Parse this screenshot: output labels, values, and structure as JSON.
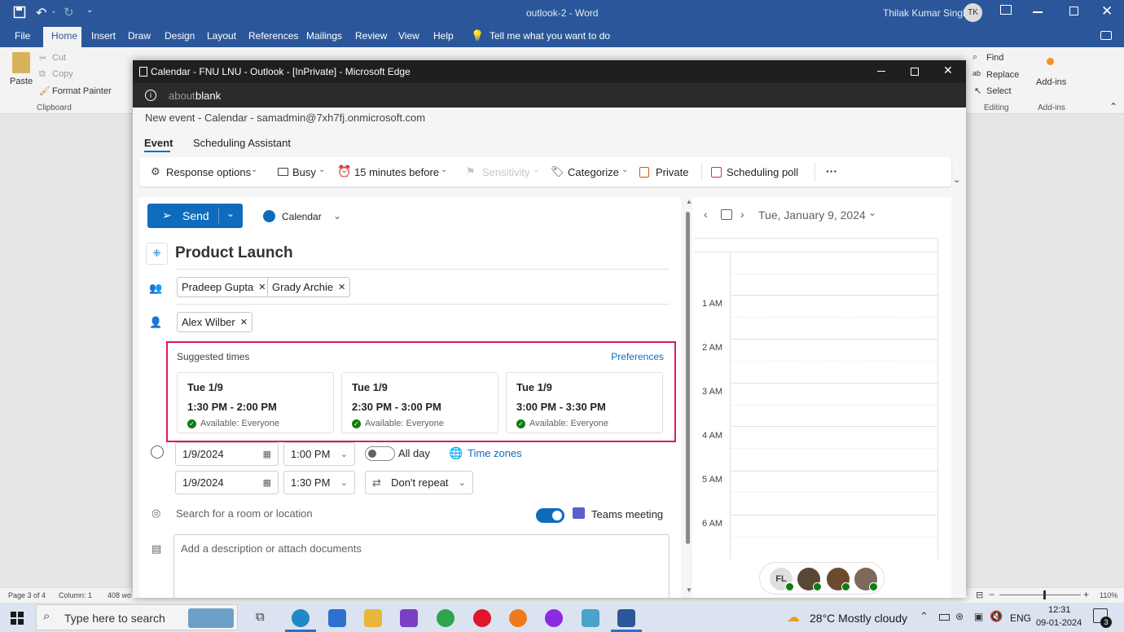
{
  "word": {
    "doc_title": "outlook-2  -  Word",
    "user_name": "Thilak Kumar Singh",
    "user_initials": "TK",
    "tabs": [
      "File",
      "Home",
      "Insert",
      "Draw",
      "Design",
      "Layout",
      "References",
      "Mailings",
      "Review",
      "View",
      "Help"
    ],
    "tell_me": "Tell me what you want to do",
    "ribbon": {
      "paste": "Paste",
      "cut": "Cut",
      "copy": "Copy",
      "format_painter": "Format Painter",
      "clipboard": "Clipboard",
      "find": "Find",
      "replace": "Replace",
      "select": "Select",
      "editing": "Editing",
      "addins": "Add-ins",
      "addins_group": "Add-ins"
    },
    "status": {
      "page": "Page 3 of 4",
      "column": "Column: 1",
      "words": "408 wo",
      "zoom": "110%"
    }
  },
  "edge": {
    "title": "Calendar - FNU LNU - Outlook - [InPrivate] - Microsoft Edge",
    "address_prefix": "about:",
    "address_main": "blank"
  },
  "outlook": {
    "header": "New event - Calendar - samadmin@7xh7fj.onmicrosoft.com",
    "tabs": [
      "Event",
      "Scheduling Assistant"
    ],
    "toolbar": {
      "response_options": "Response options",
      "busy": "Busy",
      "reminder": "15 minutes before",
      "sensitivity": "Sensitivity",
      "categorize": "Categorize",
      "private": "Private",
      "scheduling_poll": "Scheduling poll",
      "more": "···"
    },
    "send": "Send",
    "calendar_name": "Calendar",
    "calendar_color": "#0f6cbd",
    "title": "Product Launch",
    "required_attendees": [
      "Pradeep Gupta",
      "Grady Archie"
    ],
    "optional_attendees": [
      "Alex Wilber"
    ],
    "suggested": {
      "label": "Suggested times",
      "preferences": "Preferences",
      "highlight_color": "#e3185a",
      "slots": [
        {
          "day": "Tue 1/9",
          "time": "1:30 PM - 2:00 PM",
          "availability": "Available: Everyone"
        },
        {
          "day": "Tue 1/9",
          "time": "2:30 PM - 3:00 PM",
          "availability": "Available: Everyone"
        },
        {
          "day": "Tue 1/9",
          "time": "3:00 PM - 3:30 PM",
          "availability": "Available: Everyone"
        }
      ]
    },
    "start_date": "1/9/2024",
    "start_time": "1:00 PM",
    "end_date": "1/9/2024",
    "end_time": "1:30 PM",
    "all_day": "All day",
    "time_zones": "Time zones",
    "repeat": "Don't repeat",
    "location_placeholder": "Search for a room or location",
    "teams_meeting": "Teams meeting",
    "description_placeholder": "Add a description or attach documents",
    "side": {
      "date": "Tue, January 9, 2024",
      "hours": [
        "1 AM",
        "2 AM",
        "3 AM",
        "4 AM",
        "5 AM",
        "6 AM"
      ],
      "avatar_initials": "FL"
    }
  },
  "taskbar": {
    "search_placeholder": "Type here to search",
    "weather": "28°C  Mostly cloudy",
    "lang": "ENG",
    "time": "12:31",
    "date": "09-01-2024",
    "notifications": "3"
  }
}
